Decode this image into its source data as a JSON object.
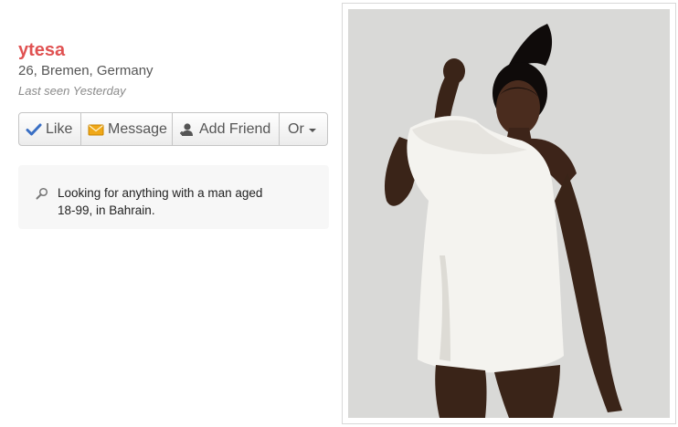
{
  "profile": {
    "username": "ytesa",
    "location": "26, Bremen, Germany",
    "last_seen": "Last seen Yesterday"
  },
  "actions": {
    "like_label": "Like",
    "message_label": "Message",
    "add_friend_label": "Add Friend",
    "more_label": "Or"
  },
  "looking_for": {
    "text": "Looking for anything with a man aged 18-99, in Bahrain."
  },
  "icons": {
    "like": "checkmark-icon",
    "message": "envelope-icon",
    "add_friend": "add-person-icon",
    "more": "caret-down-icon",
    "looking_for": "magnifier-icon"
  },
  "colors": {
    "username": "#e05252",
    "check": "#3a6fc4",
    "envelope": "#f0a818",
    "photo_background": "#d9d9d7"
  }
}
